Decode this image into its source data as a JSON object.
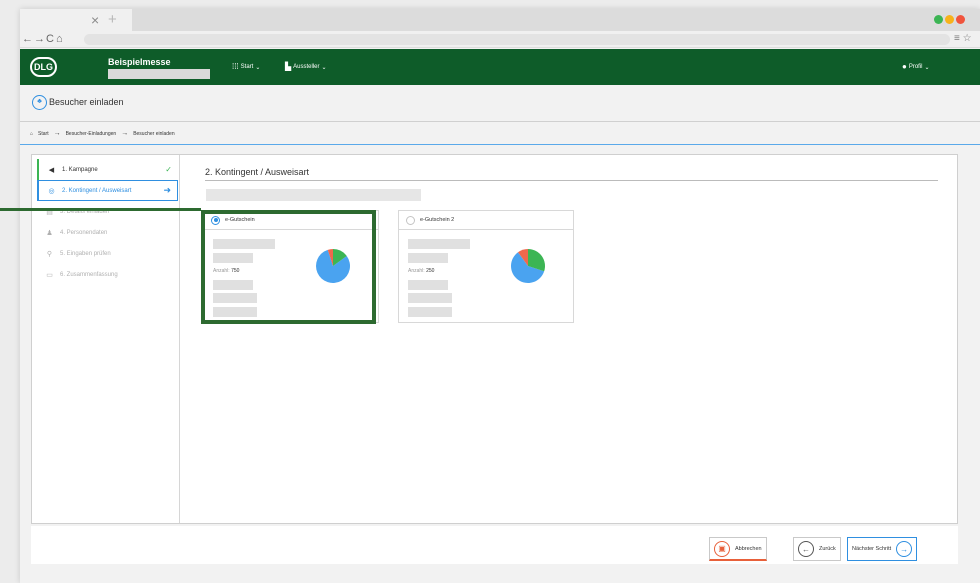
{
  "browser": {
    "tab_close": "×",
    "tab_new": "+",
    "nav_back": "←",
    "nav_forward": "→",
    "nav_reload": "C",
    "nav_home": "⌂",
    "menu": "≡ ☆",
    "dot_colors": [
      "#3cb554",
      "#f7b21a",
      "#f0543d"
    ]
  },
  "header": {
    "logo_text": "DLG",
    "fair_name": "Beispielmesse",
    "nav": {
      "start_label": "Start",
      "aussteller_label": "Aussteller",
      "profile_label": "Profil"
    },
    "brand_color": "#0e5c29"
  },
  "page": {
    "title": "Besucher einladen",
    "breadcrumb": [
      "Start",
      "Besucher-Einladungen",
      "Besucher einladen"
    ]
  },
  "steps": [
    {
      "label": "1. Kampagne",
      "state": "done",
      "icon": "megaphone-icon"
    },
    {
      "label": "2. Kontingent / Ausweisart",
      "state": "active",
      "icon": "ticket-icon"
    },
    {
      "label": "3. Details einladen",
      "state": "inactive",
      "icon": "details-icon"
    },
    {
      "label": "4. Personendaten",
      "state": "inactive",
      "icon": "person-icon"
    },
    {
      "label": "5. Eingaben prüfen",
      "state": "inactive",
      "icon": "search-icon"
    },
    {
      "label": "6. Zusammenfassung",
      "state": "inactive",
      "icon": "summary-icon"
    }
  ],
  "section": {
    "title": "2. Kontingent / Ausweisart"
  },
  "cards": [
    {
      "label": "e-Gutschein",
      "selected": true,
      "anzahl_label": "Anzahl:",
      "anzahl_value": "750",
      "pie": [
        0.8,
        0.05,
        0.15
      ]
    },
    {
      "label": "e-Gutschein 2",
      "selected": false,
      "anzahl_label": "Anzahl:",
      "anzahl_value": "250",
      "pie": [
        0.6,
        0.1,
        0.3
      ]
    }
  ],
  "footer": {
    "cancel_label": "Abbrechen",
    "back_label": "Zurück",
    "next_label": "Nächster Schritt"
  },
  "colors": {
    "accent_blue": "#2f8fe0",
    "success_green": "#3cb554",
    "cancel_orange": "#e8603a",
    "highlight_green": "#2d6a30",
    "pie": [
      "#4aa3f0",
      "#f0684d",
      "#3cb554"
    ]
  }
}
